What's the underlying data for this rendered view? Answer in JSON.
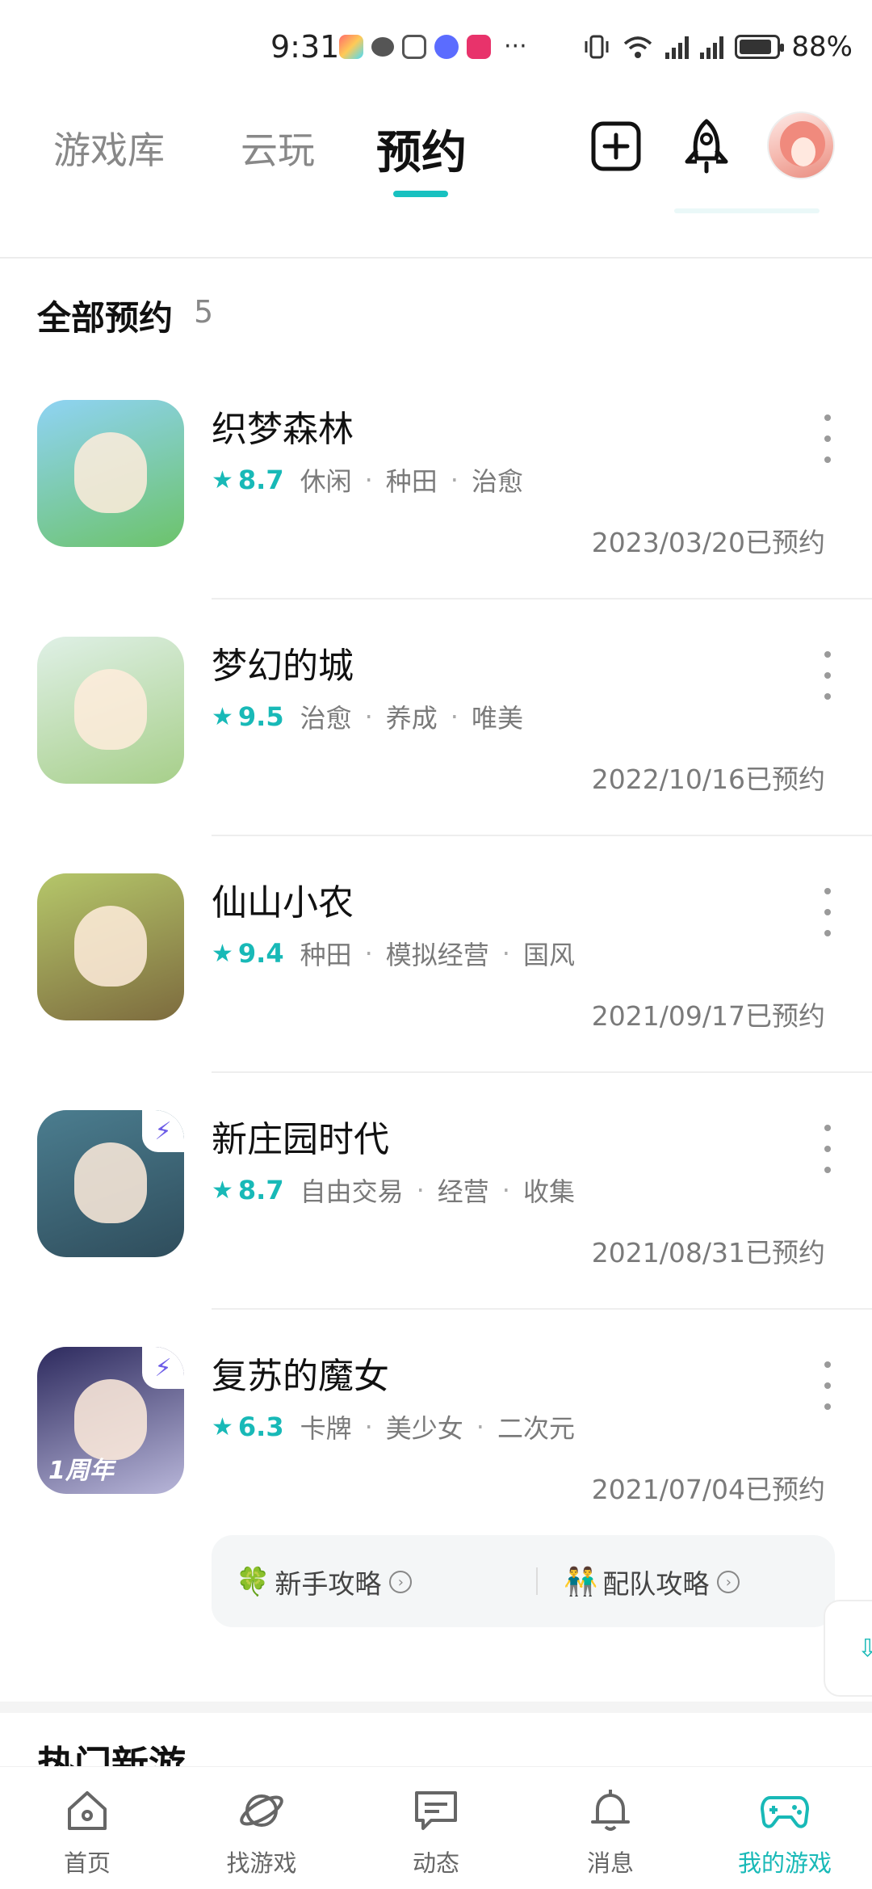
{
  "status_bar": {
    "time": "9:31",
    "battery": "88%",
    "battery_level": 0.88,
    "network": "4G",
    "more": "···"
  },
  "top_nav": {
    "tabs": [
      {
        "label": "游戏库"
      },
      {
        "label": "云玩"
      },
      {
        "label": "预约"
      }
    ],
    "active_tab": "预约",
    "add_icon": "plus-square-icon",
    "rocket_icon": "rocket-icon"
  },
  "section": {
    "title": "全部预约",
    "count": "5"
  },
  "games": [
    {
      "name": "织梦森林",
      "rating": "8.7",
      "tags": [
        "休闲",
        "种田",
        "治愈"
      ],
      "date": "2023/03/20已预约",
      "icon_colors": [
        "#8fd3f4",
        "#6cc36a"
      ],
      "badge": false
    },
    {
      "name": "梦幻的城",
      "rating": "9.5",
      "tags": [
        "治愈",
        "养成",
        "唯美"
      ],
      "date": "2022/10/16已预约",
      "icon_colors": [
        "#dff0e6",
        "#a7cf8a"
      ],
      "badge": false
    },
    {
      "name": "仙山小农",
      "rating": "9.4",
      "tags": [
        "种田",
        "模拟经营",
        "国风"
      ],
      "date": "2021/09/17已预约",
      "icon_colors": [
        "#b5c76a",
        "#7d6b3e"
      ],
      "badge": false
    },
    {
      "name": "新庄园时代",
      "rating": "8.7",
      "tags": [
        "自由交易",
        "经营",
        "收集"
      ],
      "date": "2021/08/31已预约",
      "icon_colors": [
        "#4b7d8f",
        "#2f4d5c"
      ],
      "badge": true
    },
    {
      "name": "复苏的魔女",
      "rating": "6.3",
      "tags": [
        "卡牌",
        "美少女",
        "二次元"
      ],
      "date": "2021/07/04已预约",
      "icon_colors": [
        "#2d2a5e",
        "#b8b6d9"
      ],
      "badge": true,
      "icon_text": "1周年"
    }
  ],
  "guides": [
    {
      "emoji": "🍀",
      "label": "新手攻略"
    },
    {
      "emoji": "👬",
      "label": "配队攻略"
    }
  ],
  "hot_section": {
    "title": "热门新游"
  },
  "bottom_nav": [
    {
      "label": "首页",
      "icon": "home-icon"
    },
    {
      "label": "找游戏",
      "icon": "planet-icon"
    },
    {
      "label": "动态",
      "icon": "chat-icon"
    },
    {
      "label": "消息",
      "icon": "bell-icon"
    },
    {
      "label": "我的游戏",
      "icon": "gamepad-icon"
    }
  ],
  "colors": {
    "accent": "#18b9b7",
    "text_primary": "#111111",
    "text_secondary": "#7a7a7a"
  }
}
